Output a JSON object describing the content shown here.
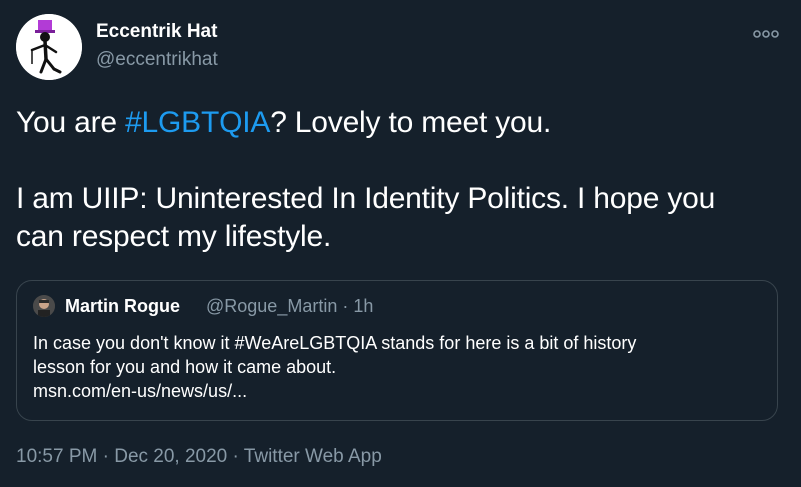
{
  "tweet": {
    "author": {
      "display_name": "Eccentrik Hat",
      "handle": "@eccentrikhat",
      "avatar_icon": "top-hat-figure-avatar-icon"
    },
    "more_icon": "more-options-icon",
    "text": {
      "line1_pre": "You are ",
      "line1_hashtag": "#LGBTQIA",
      "line1_post": "? Lovely to meet you.",
      "line2": "I am UIIP: Uninterested In Identity Politics. I hope you",
      "line3": "can respect my lifestyle."
    },
    "quoted": {
      "display_name": "Martin Rogue",
      "handle_time": "@Rogue_Martin · 1h",
      "line1": "In case you don't know it #WeAreLGBTQIA stands for here is a bit of history",
      "line2": "lesson for you and how it came about.",
      "line3": "msn.com/en-us/news/us/..."
    },
    "meta": {
      "time": "10:57 PM",
      "separator1": " · ",
      "date": "Dec 20, 2020",
      "separator2": " · ",
      "client": "Twitter Web App"
    }
  },
  "colors": {
    "background": "#15202b",
    "text": "#ffffff",
    "secondary": "#8899a6",
    "accent": "#1d9bf0",
    "border": "#38444d"
  }
}
